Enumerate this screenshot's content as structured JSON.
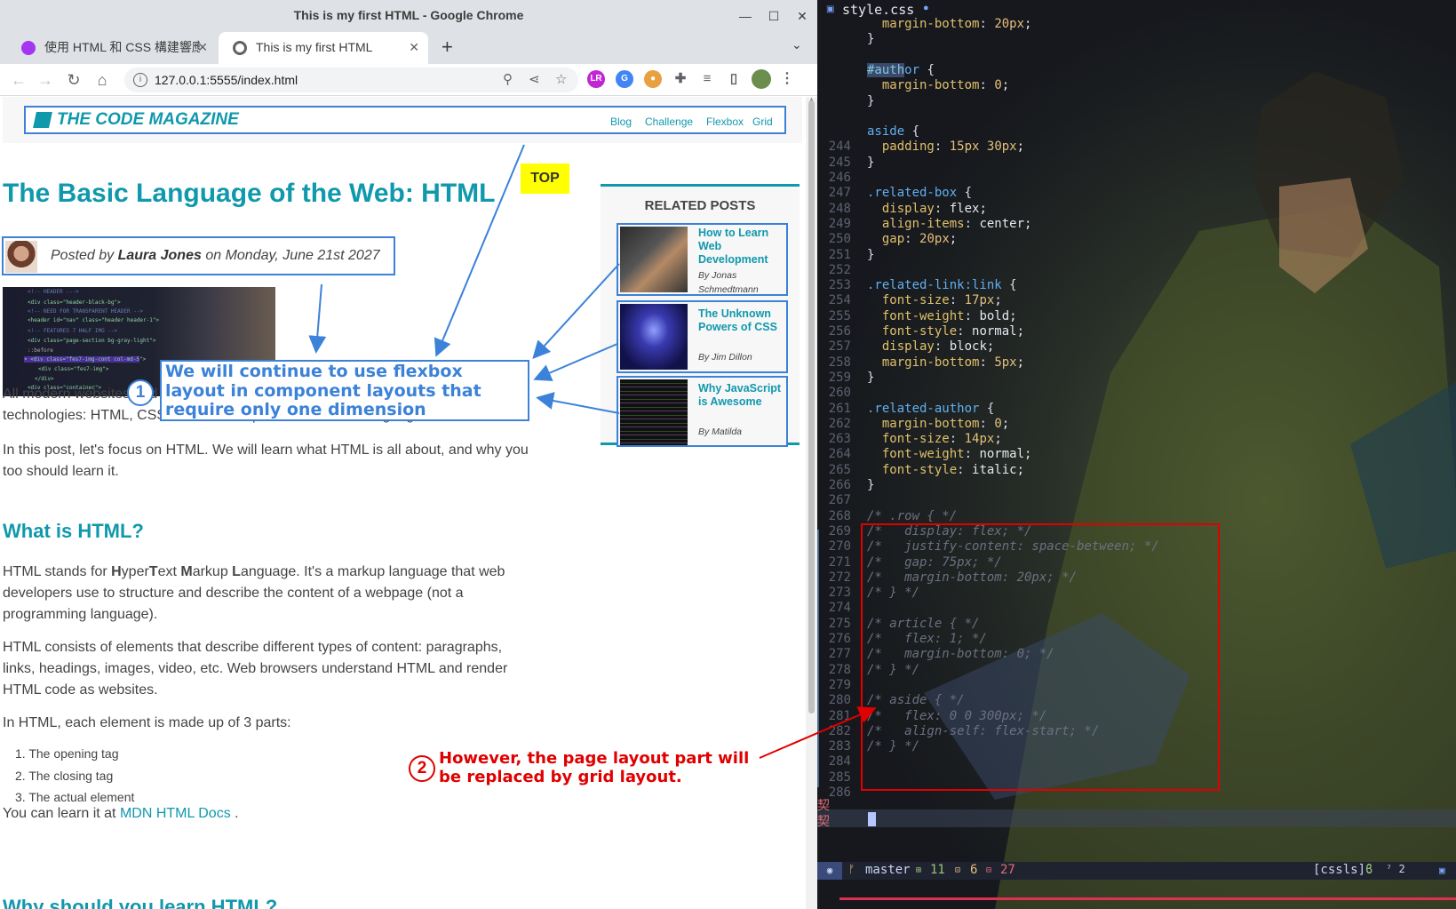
{
  "window": {
    "title": "This is my first HTML - Google Chrome"
  },
  "tabs": [
    {
      "label": "使用 HTML 和 CSS 構建響應式網",
      "active": false
    },
    {
      "label": "This is my first HTML",
      "active": true
    }
  ],
  "omnibox": {
    "url": "127.0.0.1:5555/index.html"
  },
  "site": {
    "logo": "THE CODE MAGAZINE",
    "nav": [
      "Blog",
      "Challenge",
      "Flexbox",
      "Grid"
    ]
  },
  "post": {
    "title": "The Basic Language of the Web: HTML",
    "top_button": "TOP",
    "author_prefix": "Posted by ",
    "author_name": "Laura Jones",
    "author_suffix": " on Monday, June 21st 2027",
    "intro_a": "All modern websites and",
    "intro_b": "technologies: HTML, CSS and JavaScript. These are the languages of the web.",
    "p2_line1": "In this post, let's focus on HTML. We will learn what HTML is all about, and why you",
    "p2_line2": "too should learn it.",
    "h2_what": "What is HTML?",
    "p3_line1_a": "HTML stands for ",
    "p3_H": "H",
    "p3_yper": "yper",
    "p3_T": "T",
    "p3_ext": "ext ",
    "p3_M": "M",
    "p3_arkup": "arkup ",
    "p3_L": "L",
    "p3_rest": "anguage. It's a markup language that web",
    "p3_line2": "developers use to structure and describe the content of a webpage (not a",
    "p3_line3": "programming language).",
    "p4_line1": "HTML consists of elements that describe different types of content: paragraphs,",
    "p4_line2": "links, headings, images, video, etc. Web browsers understand HTML and render",
    "p4_line3": "HTML code as websites.",
    "p5": "In HTML, each element is made up of 3 parts:",
    "list": [
      "1. The opening tag",
      "2. The closing tag",
      "3. The actual element"
    ],
    "learn_a": "You can learn it at ",
    "learn_link": "MDN HTML Docs",
    "learn_b": " .",
    "h2_why": "Why should you learn HTML?"
  },
  "related": {
    "title": "RELATED POSTS",
    "posts": [
      {
        "title": "How to Learn Web Development",
        "author": "By Jonas Schmedtmann"
      },
      {
        "title": "The Unknown Powers of CSS",
        "author": "By Jim Dillon"
      },
      {
        "title": "Why JavaScript is Awesome",
        "author": "By Matilda"
      }
    ]
  },
  "annotations": {
    "note1_num": "1",
    "note1": "We will continue to use flexbox layout in component layouts that require only one dimension",
    "note2_num": "2",
    "note2_line1": "However, the page layout part will",
    "note2_line2": "be replaced by grid layout."
  },
  "editor": {
    "filename": "style.css",
    "lines": [
      {
        "n": "",
        "t": "  margin-bottom: 20px;"
      },
      {
        "n": "",
        "t": "}"
      },
      {
        "n": "",
        "t": ""
      },
      {
        "n": "",
        "t": "#author {"
      },
      {
        "n": "",
        "t": "  margin-bottom: 0;"
      },
      {
        "n": "",
        "t": "}"
      },
      {
        "n": "",
        "t": ""
      },
      {
        "n": "",
        "t": "aside {"
      },
      {
        "n": "244",
        "t": "  padding: 15px 30px;"
      },
      {
        "n": "245",
        "t": "}"
      },
      {
        "n": "246",
        "t": ""
      },
      {
        "n": "247",
        "t": ".related-box {"
      },
      {
        "n": "248",
        "t": "  display: flex;"
      },
      {
        "n": "249",
        "t": "  align-items: center;"
      },
      {
        "n": "250",
        "t": "  gap: 20px;"
      },
      {
        "n": "251",
        "t": "}"
      },
      {
        "n": "252",
        "t": ""
      },
      {
        "n": "253",
        "t": ".related-link:link {"
      },
      {
        "n": "254",
        "t": "  font-size: 17px;"
      },
      {
        "n": "255",
        "t": "  font-weight: bold;"
      },
      {
        "n": "256",
        "t": "  font-style: normal;"
      },
      {
        "n": "257",
        "t": "  display: block;"
      },
      {
        "n": "258",
        "t": "  margin-bottom: 5px;"
      },
      {
        "n": "259",
        "t": "}"
      },
      {
        "n": "260",
        "t": ""
      },
      {
        "n": "261",
        "t": ".related-author {"
      },
      {
        "n": "262",
        "t": "  margin-bottom: 0;"
      },
      {
        "n": "263",
        "t": "  font-size: 14px;"
      },
      {
        "n": "264",
        "t": "  font-weight: normal;"
      },
      {
        "n": "265",
        "t": "  font-style: italic;"
      },
      {
        "n": "266",
        "t": "}"
      },
      {
        "n": "267",
        "t": ""
      },
      {
        "n": "268",
        "t": "/* .row { */"
      },
      {
        "n": "269",
        "t": "/*   display: flex; */"
      },
      {
        "n": "270",
        "t": "/*   justify-content: space-between; */"
      },
      {
        "n": "271",
        "t": "/*   gap: 75px; */"
      },
      {
        "n": "272",
        "t": "/*   margin-bottom: 20px; */"
      },
      {
        "n": "273",
        "t": "/* } */"
      },
      {
        "n": "274",
        "t": ""
      },
      {
        "n": "275",
        "t": "/* article { */"
      },
      {
        "n": "276",
        "t": "/*   flex: 1; */"
      },
      {
        "n": "277",
        "t": "/*   margin-bottom: 0; */"
      },
      {
        "n": "278",
        "t": "/* } */"
      },
      {
        "n": "279",
        "t": ""
      },
      {
        "n": "280",
        "t": "/* aside { */"
      },
      {
        "n": "281",
        "t": "/*   flex: 0 0 300px; */"
      },
      {
        "n": "282",
        "t": "/*   align-self: flex-start; */"
      },
      {
        "n": "283",
        "t": "/* } */"
      },
      {
        "n": "284",
        "t": ""
      },
      {
        "n": "285",
        "t": ""
      },
      {
        "n": "286",
        "t": ""
      }
    ],
    "sign": "契",
    "status": {
      "branch": "master",
      "added": "11",
      "changed": "6",
      "removed": "27",
      "lsp": "[cssls]",
      "misc": "⁷ 2"
    }
  }
}
